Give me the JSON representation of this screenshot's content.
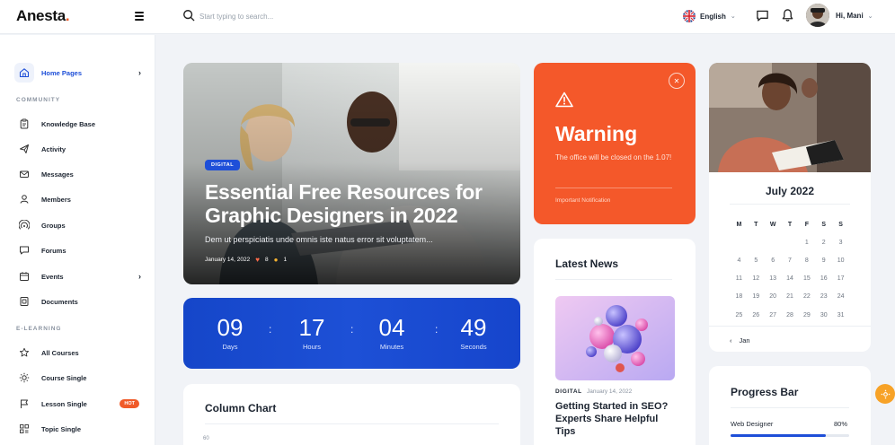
{
  "app": {
    "logo": "Anesta",
    "logo_dot": "."
  },
  "header": {
    "search_placeholder": "Start typing to search...",
    "language": "English",
    "greeting": "Hi,  Mani"
  },
  "sidebar": {
    "home": "Home Pages",
    "community_label": "COMMUNITY",
    "community": [
      "Knowledge Base",
      "Activity",
      "Messages",
      "Members",
      "Groups",
      "Forums",
      "Events",
      "Documents"
    ],
    "elearning_label": "E-LEARNING",
    "elearning": [
      "All Courses",
      "Course Single",
      "Lesson Single",
      "Topic Single"
    ],
    "hot_badge": "HOT"
  },
  "hero": {
    "badge": "DIGITAL",
    "title": "Essential Free Resources for Graphic Designers in 2022",
    "subtitle": "Dem ut perspiciatis unde omnis iste natus error sit voluptatem...",
    "date": "January 14, 2022",
    "likes": "8",
    "claps": "1"
  },
  "countdown": {
    "units": [
      {
        "value": "09",
        "label": "Days"
      },
      {
        "value": "17",
        "label": "Hours"
      },
      {
        "value": "04",
        "label": "Minutes"
      },
      {
        "value": "49",
        "label": "Seconds"
      }
    ],
    "separator": ":"
  },
  "chart_card": {
    "title": "Column Chart",
    "tick": "60"
  },
  "warning": {
    "title": "Warning",
    "text": "The office will be closed on the 1.07!",
    "footer": "Important Notification"
  },
  "news": {
    "title": "Latest News",
    "category": "DIGITAL",
    "date": "January 14, 2022",
    "headline": "Getting Started in SEO? Experts Share Helpful Tips"
  },
  "calendar": {
    "month": "July 2022",
    "weekdays": [
      "M",
      "T",
      "W",
      "T",
      "F",
      "S",
      "S"
    ],
    "weeks": [
      [
        "",
        "",
        "",
        "",
        "1",
        "2",
        "3"
      ],
      [
        "4",
        "5",
        "6",
        "7",
        "8",
        "9",
        "10"
      ],
      [
        "11",
        "12",
        "13",
        "14",
        "15",
        "16",
        "17"
      ],
      [
        "18",
        "19",
        "20",
        "21",
        "22",
        "23",
        "24"
      ],
      [
        "25",
        "26",
        "27",
        "28",
        "29",
        "30",
        "31"
      ]
    ],
    "prev": "Jan"
  },
  "progress": {
    "title": "Progress Bar",
    "label": "Web Designer",
    "percent": "80%",
    "value": 0.8
  },
  "colors": {
    "accent": "#1e4fd8",
    "warning": "#f4582a",
    "hot": "#f05a28"
  }
}
